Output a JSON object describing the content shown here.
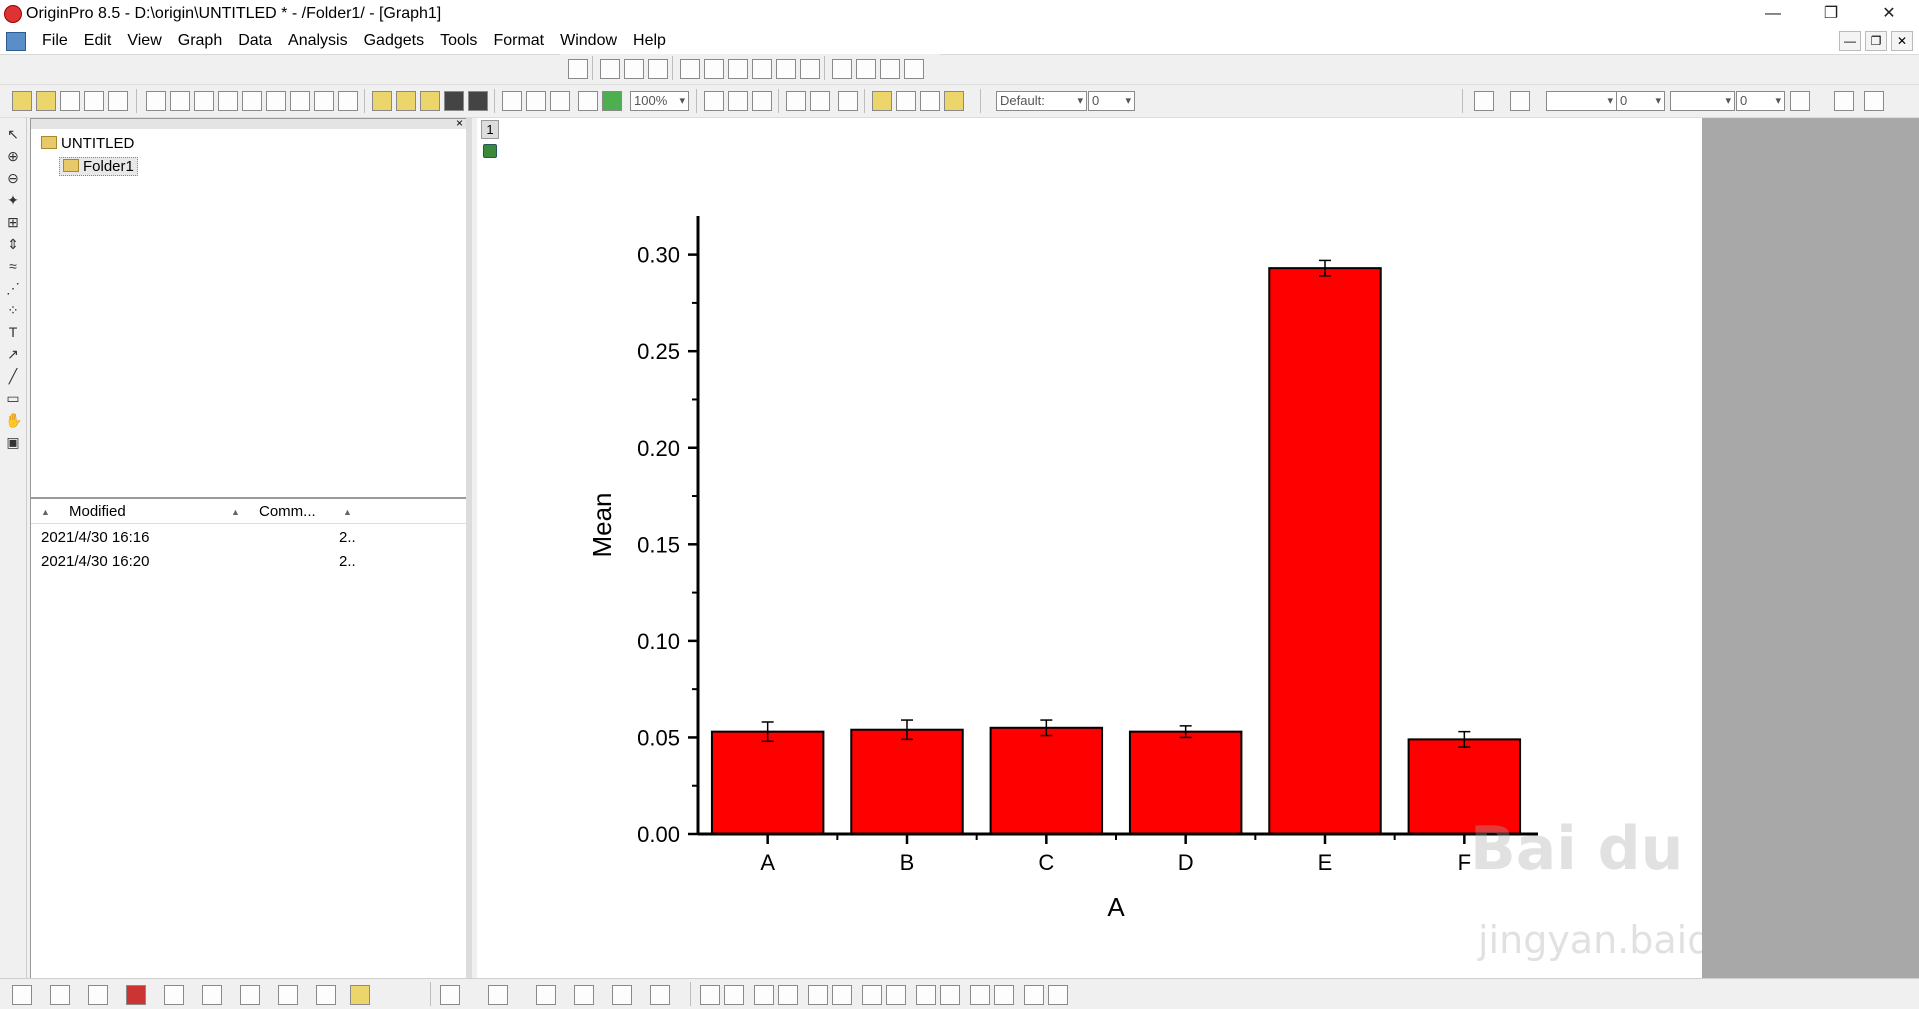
{
  "window": {
    "title": "OriginPro 8.5 - D:\\origin\\UNTITLED * - /Folder1/ - [Graph1]",
    "minimize": "—",
    "restore": "❐",
    "close": "✕"
  },
  "menu": {
    "items": [
      "File",
      "Edit",
      "View",
      "Graph",
      "Data",
      "Analysis",
      "Gadgets",
      "Tools",
      "Format",
      "Window",
      "Help"
    ]
  },
  "toolbar": {
    "zoom": "100%",
    "font": "Default:",
    "font_size": "0",
    "line_width": "0",
    "border_width": "0"
  },
  "project_explorer": {
    "root": "UNTITLED",
    "folder": "Folder1",
    "columns": [
      "Modified",
      "Comm..."
    ],
    "rows": [
      {
        "modified": "2021/4/30 16:16",
        "comment": "2.."
      },
      {
        "modified": "2021/4/30 16:20",
        "comment": "2.."
      }
    ]
  },
  "graph": {
    "layer_tab": "1"
  },
  "watermark": {
    "brand": "Bai du 经验",
    "url": "jingyan.baidu.com"
  },
  "colors": {
    "bar_fill": "#ff0000",
    "bar_edge": "#000000",
    "workspace": "#a8a8a8"
  },
  "chart_data": {
    "type": "bar",
    "categories": [
      "A",
      "B",
      "C",
      "D",
      "E",
      "F"
    ],
    "values": [
      0.053,
      0.054,
      0.055,
      0.053,
      0.293,
      0.049
    ],
    "errors": [
      0.005,
      0.005,
      0.004,
      0.003,
      0.004,
      0.004
    ],
    "xlabel": "A",
    "ylabel": "Mean",
    "ylim": [
      0,
      0.32
    ],
    "yticks": [
      "0.00",
      "0.05",
      "0.10",
      "0.15",
      "0.20",
      "0.25",
      "0.30"
    ],
    "ytick_values": [
      0,
      0.05,
      0.1,
      0.15,
      0.2,
      0.25,
      0.3
    ],
    "grid": false,
    "legend": "none"
  }
}
